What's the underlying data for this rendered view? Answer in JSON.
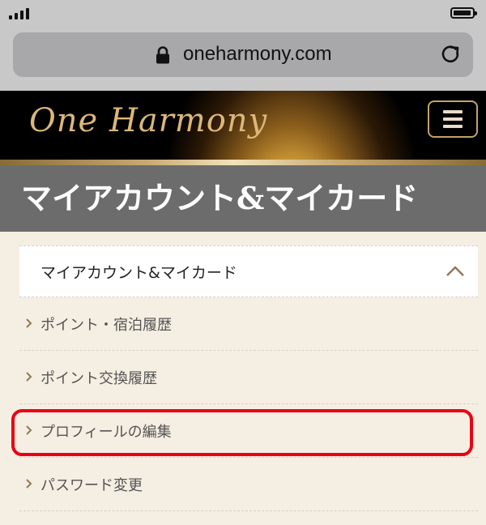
{
  "browser": {
    "url": "oneharmony.com"
  },
  "site": {
    "logo_text": "One Harmony",
    "menu_icon": "hamburger-menu-icon"
  },
  "page": {
    "title": "マイアカウント&マイカード"
  },
  "account_menu": {
    "header_label": "マイアカウント&マイカード",
    "items": [
      {
        "label": "ポイント・宿泊履歴"
      },
      {
        "label": "ポイント交換履歴"
      },
      {
        "label": "プロフィールの編集",
        "highlighted": true
      },
      {
        "label": "パスワード変更"
      }
    ]
  },
  "colors": {
    "highlight": "#ea0015",
    "gold": "#c4a169",
    "page_background": "#f5eee2"
  }
}
